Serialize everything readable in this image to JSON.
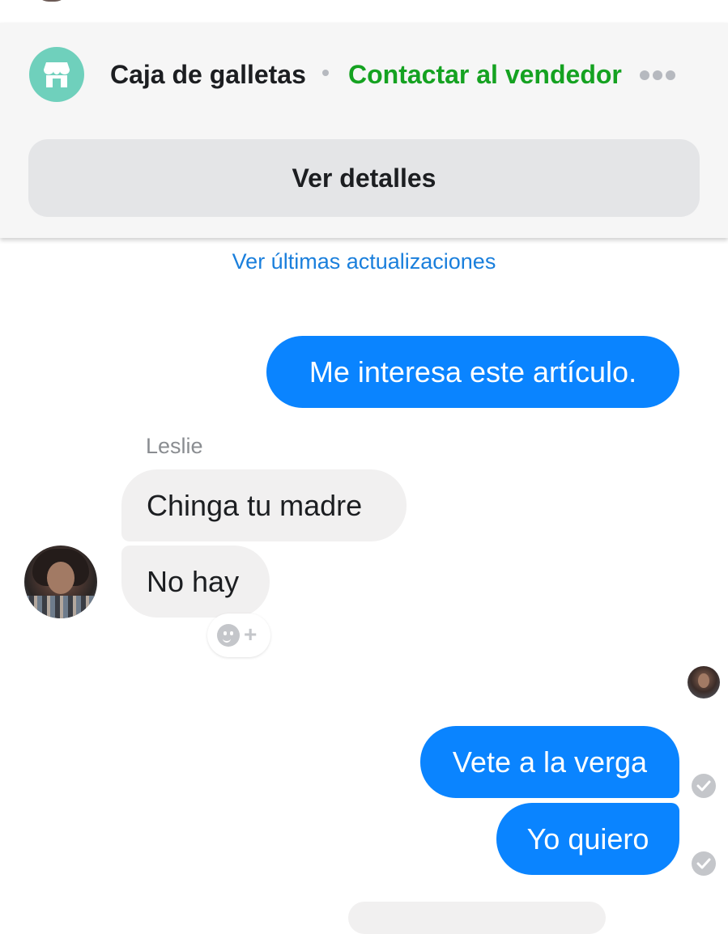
{
  "listing": {
    "title": "Caja de galletas",
    "separator": "•",
    "contact_label": "Contactar al vendedor",
    "details_label": "Ver detalles",
    "accent_color": "#15a221",
    "icon": "shop-icon"
  },
  "thread": {
    "updates_link": "Ver últimas actualizaciones",
    "sender_name": "Leslie",
    "messages": [
      {
        "from": "me",
        "text": "Me interesa este artículo."
      },
      {
        "from": "Leslie",
        "text": "Chinga tu madre"
      },
      {
        "from": "Leslie",
        "text": "No hay"
      },
      {
        "from": "me",
        "text": "Vete a la verga",
        "status": "sent"
      },
      {
        "from": "me",
        "text": "Yo quiero",
        "status": "sent"
      }
    ]
  },
  "colors": {
    "outgoing_bubble": "#0a84ff",
    "incoming_bubble": "#f1f0f0",
    "link_blue": "#1a7fdc"
  }
}
